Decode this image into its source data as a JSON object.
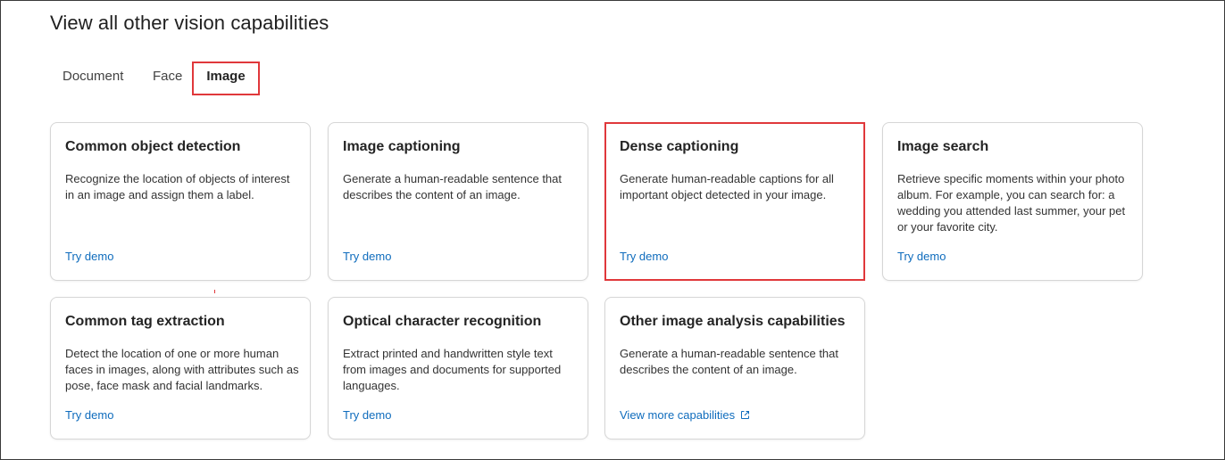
{
  "page": {
    "title": "View all other vision capabilities"
  },
  "tabs": [
    {
      "label": "Document",
      "selected": false
    },
    {
      "label": "Face",
      "selected": false
    },
    {
      "label": "Image",
      "selected": true
    }
  ],
  "cards": [
    {
      "title": "Common object detection",
      "description": "Recognize the location of objects of interest in an image and assign them a label.",
      "link": "Try demo"
    },
    {
      "title": "Image captioning",
      "description": "Generate a human-readable sentence that describes the content of an image.",
      "link": "Try demo"
    },
    {
      "title": "Dense captioning",
      "description": "Generate human-readable captions for all important object detected in your image.",
      "link": "Try demo",
      "highlighted": true
    },
    {
      "title": "Image search",
      "description": "Retrieve specific moments within your photo album. For example, you can search for: a wedding you attended last summer, your pet or your favorite city.",
      "link": "Try demo"
    },
    {
      "title": "Common tag extraction",
      "description": "Detect the location of one or more human faces in images, along with attributes such as pose, face mask and facial landmarks.",
      "link": "Try demo"
    },
    {
      "title": "Optical character recognition",
      "description": "Extract printed and handwritten style text from images and documents for supported languages.",
      "link": "Try demo"
    },
    {
      "title": "Other image analysis capabilities",
      "description": "Generate a human-readable sentence that describes the content of an image.",
      "link": "View more capabilities",
      "link_icon": "external-link-icon"
    }
  ],
  "colors": {
    "link": "#0f6cbd",
    "highlight_border": "#e0383b",
    "card_border": "#d6d6d6"
  }
}
